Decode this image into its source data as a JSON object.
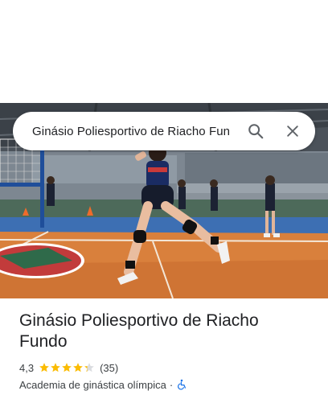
{
  "search": {
    "query": "Ginásio Poliesportivo de Riacho Fun",
    "search_icon": "search-icon",
    "close_icon": "close-icon"
  },
  "photo": {
    "subject": "volleyball players on indoor court"
  },
  "place": {
    "name": "Ginásio Poliesportivo de Riacho Fundo",
    "rating": "4,3",
    "rating_value": 4.3,
    "review_count": "(35)",
    "category": "Academia de ginástica olímpica",
    "separator": "·",
    "accessibility_icon": "wheelchair-icon"
  },
  "colors": {
    "star": "#fbbc04",
    "star_empty": "#dadce0",
    "accessibility": "#1a73e8",
    "text_primary": "#202124",
    "text_secondary": "#3c4043"
  }
}
